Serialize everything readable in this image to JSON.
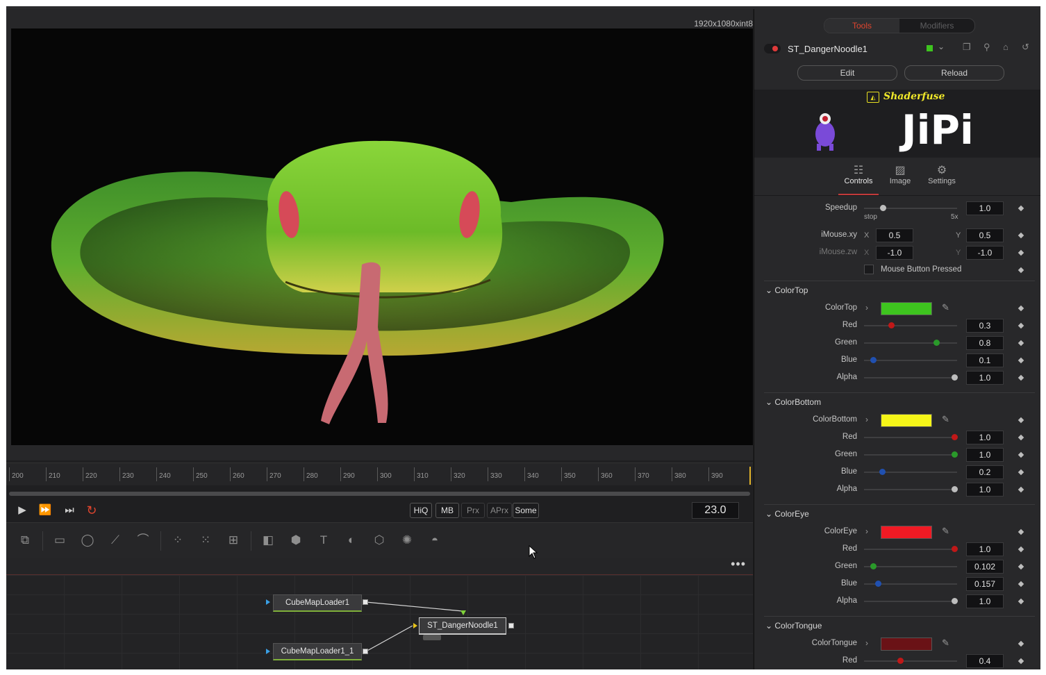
{
  "viewer": {
    "resolution": "1920x1080xint8",
    "ruler_ticks": [
      "200",
      "210",
      "220",
      "230",
      "240",
      "250",
      "260",
      "270",
      "280",
      "290",
      "300",
      "310",
      "320",
      "330",
      "340",
      "350",
      "360",
      "370",
      "380",
      "390"
    ]
  },
  "transport": {
    "play": "▶",
    "step_forward": "⏩",
    "to_end": "⏭",
    "loop": "↻",
    "toggles": [
      {
        "label": "HiQ",
        "active": true
      },
      {
        "label": "MB",
        "active": true
      },
      {
        "label": "Prx",
        "active": false
      },
      {
        "label": "APrx",
        "active": false
      },
      {
        "label": "Some",
        "active": true
      }
    ],
    "frame": "23.0"
  },
  "nodes": {
    "more": "•••",
    "items": [
      "CubeMapLoader1",
      "ST_DangerNoodle1",
      "CubeMapLoader1_1"
    ]
  },
  "inspector": {
    "tabs": [
      "Tools",
      "Modifiers"
    ],
    "tool_name": "ST_DangerNoodle1",
    "edit": "Edit",
    "reload": "Reload",
    "brand_name": "Shaderfuse",
    "logo_text": "JiPi",
    "section_tabs": [
      "Controls",
      "Image",
      "Settings"
    ],
    "speedup": {
      "label": "Speedup",
      "value": "1.0",
      "min": "stop",
      "max": "5x",
      "level": 0.2
    },
    "imouse_xy": {
      "label": "iMouse.xy",
      "x_label": "X",
      "x": "0.5",
      "y_label": "Y",
      "y": "0.5"
    },
    "imouse_zw": {
      "label": "iMouse.zw",
      "x_label": "X",
      "x": "-1.0",
      "y_label": "Y",
      "y": "-1.0"
    },
    "mouse_button": "Mouse Button Pressed",
    "groups": [
      {
        "title": "ColorTop",
        "swatch_label": "ColorTop",
        "color": "#3ec41f",
        "channels": [
          {
            "name": "Red",
            "value": "0.3",
            "level": 0.3,
            "dot": "#c01818"
          },
          {
            "name": "Green",
            "value": "0.8",
            "level": 0.8,
            "dot": "#2a9a2a"
          },
          {
            "name": "Blue",
            "value": "0.1",
            "level": 0.1,
            "dot": "#2050b0"
          },
          {
            "name": "Alpha",
            "value": "1.0",
            "level": 1.0,
            "dot": "#bdbdbd"
          }
        ]
      },
      {
        "title": "ColorBottom",
        "swatch_label": "ColorBottom",
        "color": "#f5f518",
        "channels": [
          {
            "name": "Red",
            "value": "1.0",
            "level": 1.0,
            "dot": "#c01818"
          },
          {
            "name": "Green",
            "value": "1.0",
            "level": 1.0,
            "dot": "#2a9a2a"
          },
          {
            "name": "Blue",
            "value": "0.2",
            "level": 0.2,
            "dot": "#2050b0"
          },
          {
            "name": "Alpha",
            "value": "1.0",
            "level": 1.0,
            "dot": "#bdbdbd"
          }
        ]
      },
      {
        "title": "ColorEye",
        "swatch_label": "ColorEye",
        "color": "#f01a24",
        "channels": [
          {
            "name": "Red",
            "value": "1.0",
            "level": 1.0,
            "dot": "#c01818"
          },
          {
            "name": "Green",
            "value": "0.102",
            "level": 0.102,
            "dot": "#2a9a2a"
          },
          {
            "name": "Blue",
            "value": "0.157",
            "level": 0.157,
            "dot": "#2050b0"
          },
          {
            "name": "Alpha",
            "value": "1.0",
            "level": 1.0,
            "dot": "#bdbdbd"
          }
        ]
      },
      {
        "title": "ColorTongue",
        "swatch_label": "ColorTongue",
        "color": "#6a1216",
        "channels": [
          {
            "name": "Red",
            "value": "0.4",
            "level": 0.4,
            "dot": "#c01818"
          }
        ]
      }
    ]
  }
}
